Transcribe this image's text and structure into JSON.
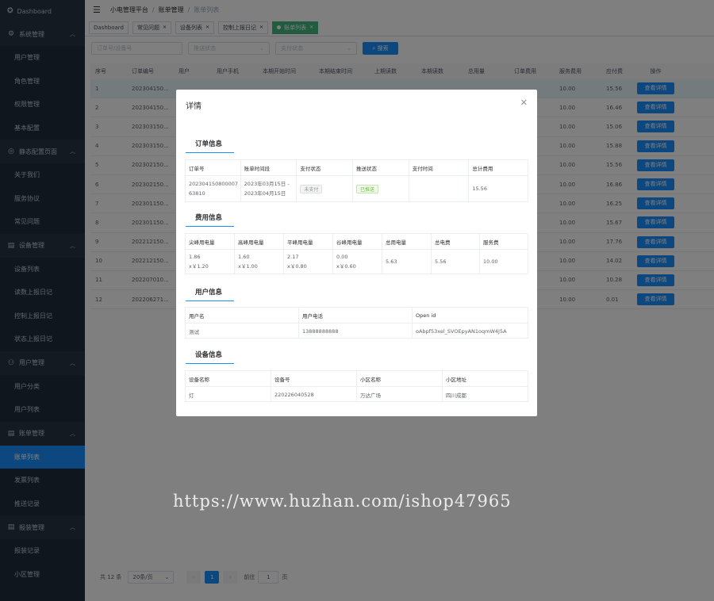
{
  "sidebar": {
    "top": {
      "label": "Dashboard",
      "icon": "dashboard-icon"
    },
    "groups": [
      {
        "label": "系统管理",
        "icon": "gear-icon",
        "items": [
          "用户管理",
          "角色管理",
          "权限管理",
          "基本配置"
        ]
      },
      {
        "label": "静态配置页面",
        "icon": "settings-circle-icon",
        "items": [
          "关于我们",
          "服务协议",
          "常见问题"
        ]
      },
      {
        "label": "设备管理",
        "icon": "document-icon",
        "items": [
          "设备列表",
          "读数上报日记",
          "控制上报日记",
          "状态上报日记"
        ]
      },
      {
        "label": "用户管理",
        "icon": "user-icon",
        "items": [
          "用户分类",
          "用户列表"
        ]
      },
      {
        "label": "账单管理",
        "icon": "document-icon",
        "items": [
          "账单列表",
          "发票列表",
          "推送记录"
        ]
      },
      {
        "label": "报装管理",
        "icon": "document-icon",
        "items": [
          "报装记录",
          "小区管理"
        ]
      }
    ],
    "active_item": "账单列表"
  },
  "header": {
    "breadcrumb": [
      "小电管理平台",
      "账单管理",
      "账单列表"
    ]
  },
  "tags": [
    {
      "label": "Dashboard"
    },
    {
      "label": "常见问题"
    },
    {
      "label": "设备列表"
    },
    {
      "label": "控制上报日记"
    },
    {
      "label": "账单列表",
      "active": true
    }
  ],
  "filters": {
    "order_placeholder": "订单号/设备号",
    "push_status_placeholder": "推送状态",
    "pay_status_placeholder": "支付状态",
    "search_label": "搜索"
  },
  "table": {
    "columns": [
      "序号",
      "订单编号",
      "用户",
      "用户手机",
      "本期开始时间",
      "本期结束时间",
      "上期读数",
      "本期读数",
      "总用量",
      "订单费用",
      "服务费用",
      "应付费",
      "操作"
    ],
    "rows": [
      {
        "idx": "1",
        "order": "202304150...",
        "service": "10.00",
        "due": "15.56"
      },
      {
        "idx": "2",
        "order": "202304150...",
        "service": "10.00",
        "due": "16.46"
      },
      {
        "idx": "3",
        "order": "202303150...",
        "service": "10.00",
        "due": "15.06"
      },
      {
        "idx": "4",
        "order": "202303150...",
        "service": "10.00",
        "due": "15.88"
      },
      {
        "idx": "5",
        "order": "202302150...",
        "service": "10.00",
        "due": "15.56"
      },
      {
        "idx": "6",
        "order": "202302150...",
        "service": "10.00",
        "due": "16.86"
      },
      {
        "idx": "7",
        "order": "202301150...",
        "service": "10.00",
        "due": "16.25"
      },
      {
        "idx": "8",
        "order": "202301150...",
        "service": "10.00",
        "due": "15.67"
      },
      {
        "idx": "9",
        "order": "202212150...",
        "service": "10.00",
        "due": "17.76"
      },
      {
        "idx": "10",
        "order": "202212150...",
        "service": "10.00",
        "due": "14.02"
      },
      {
        "idx": "11",
        "order": "202207010...",
        "service": "10.00",
        "due": "10.28"
      },
      {
        "idx": "12",
        "order": "202206271...",
        "service": "10.00",
        "due": "0.01"
      }
    ],
    "action_label": "查看详情"
  },
  "pagination": {
    "total": "共 12 条",
    "page_size": "20条/页",
    "current": "1",
    "goto_label": "前往",
    "goto_value": "1",
    "page_unit": "页"
  },
  "modal": {
    "title": "详情",
    "order_section": {
      "title": "订单信息",
      "headers": [
        "订单号",
        "账单时间段",
        "支付状态",
        "推送状态",
        "支付时间",
        "总计费用"
      ],
      "values": {
        "order_no": "20230415080000763810",
        "period": "2023年03月15日 - 2023年04月15日",
        "pay_status": "未支付",
        "push_status": "已推送",
        "pay_time": "",
        "total": "15.56"
      }
    },
    "fee_section": {
      "title": "费用信息",
      "headers": [
        "尖峰用电量",
        "高峰用电量",
        "平峰用电量",
        "谷峰用电量",
        "总用电量",
        "总电费",
        "服务费"
      ],
      "values": [
        {
          "qty": "1.86",
          "price": "x￥1.20"
        },
        {
          "qty": "1.60",
          "price": "x￥1.00"
        },
        {
          "qty": "2.17",
          "price": "x￥0.80"
        },
        {
          "qty": "0.00",
          "price": "x￥0.60"
        },
        {
          "qty": "5.63",
          "price": ""
        },
        {
          "qty": "5.56",
          "price": ""
        },
        {
          "qty": "10.00",
          "price": ""
        }
      ]
    },
    "user_section": {
      "title": "用户信息",
      "headers": [
        "用户名",
        "用户电话",
        "Open id"
      ],
      "values": [
        "测试",
        "13888888888",
        "oAbpf53xel_SVOEpyAN1oqmW4J5A"
      ]
    },
    "device_section": {
      "title": "设备信息",
      "headers": [
        "设备名称",
        "设备号",
        "小区名称",
        "小区地址"
      ],
      "values": [
        "灯",
        "220226040528",
        "万达广场",
        "四川成都"
      ]
    }
  },
  "watermark": "https://www.huzhan.com/ishop47965"
}
